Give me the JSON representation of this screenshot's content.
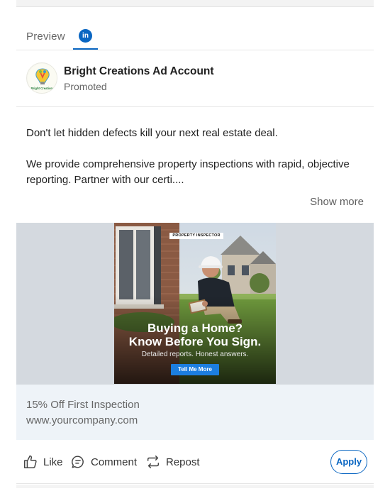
{
  "tabs": {
    "preview_label": "Preview",
    "linkedin_icon_text": "in",
    "active_color": "#0a66c2"
  },
  "post": {
    "account_name": "Bright Creations Ad Account",
    "promoted_label": "Promoted",
    "avatar_text": "Bright Creations",
    "body_paragraph_1": "Don't let hidden defects kill your next real estate deal.",
    "body_paragraph_2": "We provide comprehensive property inspections with rapid, objective reporting. Partner with our certi....",
    "show_more_label": "Show more"
  },
  "ad_creative": {
    "label": "PROPERTY INSPECTOR",
    "headline_line1": "Buying a Home?",
    "headline_line2": "Know Before You Sign.",
    "subline": "Detailed reports. Honest answers.",
    "cta_label": "Tell Me More"
  },
  "ad_footer": {
    "offer_text": "15% Off First Inspection",
    "website": "www.yourcompany.com"
  },
  "actions": {
    "like_label": "Like",
    "comment_label": "Comment",
    "repost_label": "Repost",
    "apply_label": "Apply",
    "icons": [
      "thumbs-up-icon",
      "comment-icon",
      "repost-icon"
    ]
  },
  "colors": {
    "brand_blue": "#0a66c2",
    "cta_blue": "#1c7ee0",
    "ad_background": "#d4d9df",
    "info_band": "#eef3f8"
  }
}
